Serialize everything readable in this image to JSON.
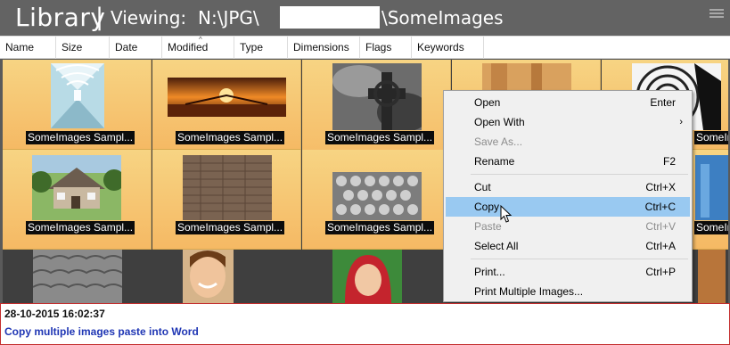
{
  "header": {
    "title": "Library",
    "separator": "|",
    "viewing_label": "Viewing:",
    "path_prefix": "N:\\JPG\\",
    "folder": "\\SomeImages"
  },
  "columns": [
    "Name",
    "Size",
    "Date",
    "Modified",
    "Type",
    "Dimensions",
    "Flags",
    "Keywords"
  ],
  "thumbnails": [
    {
      "caption": "SomeImages Sampl...",
      "icon": "corridor-photo",
      "selected": true
    },
    {
      "caption": "SomeImages Sampl...",
      "icon": "sunset-pier-photo",
      "selected": true
    },
    {
      "caption": "SomeImages Sampl...",
      "icon": "celtic-cross-photo",
      "selected": true
    },
    {
      "caption": "",
      "icon": "wood-texture-photo",
      "selected": true
    },
    {
      "caption": "SomeImages Sampl...",
      "icon": "spiral-staircase-photo",
      "selected": true
    },
    {
      "caption": "SomeImages Sampl...",
      "icon": "house-photo",
      "selected": true
    },
    {
      "caption": "SomeImages Sampl...",
      "icon": "brick-wall-photo",
      "selected": true
    },
    {
      "caption": "SomeImages Sampl...",
      "icon": "pattern-photo",
      "selected": true
    },
    {
      "caption": "",
      "icon": "blank",
      "selected": true
    },
    {
      "caption": "SomeImages Sampl...",
      "icon": "blue-building-photo",
      "selected": true
    },
    {
      "caption": "",
      "icon": "roof-tiles-photo",
      "selected": false
    },
    {
      "caption": "",
      "icon": "smiling-woman-photo",
      "selected": false
    },
    {
      "caption": "",
      "icon": "red-hood-photo",
      "selected": false
    },
    {
      "caption": "",
      "icon": "gray-photo",
      "selected": false
    },
    {
      "caption": "",
      "icon": "orange-photo",
      "selected": false
    }
  ],
  "context_menu": [
    {
      "label": "Open",
      "shortcut": "Enter",
      "disabled": false,
      "highlighted": false,
      "submenu": false
    },
    {
      "label": "Open With",
      "shortcut": "",
      "disabled": false,
      "highlighted": false,
      "submenu": true
    },
    {
      "label": "Save As...",
      "shortcut": "",
      "disabled": true,
      "highlighted": false,
      "submenu": false
    },
    {
      "label": "Rename",
      "shortcut": "F2",
      "disabled": false,
      "highlighted": false,
      "submenu": false
    },
    {
      "label": "Cut",
      "shortcut": "Ctrl+X",
      "disabled": false,
      "highlighted": false,
      "submenu": false
    },
    {
      "label": "Copy",
      "shortcut": "Ctrl+C",
      "disabled": false,
      "highlighted": true,
      "submenu": false
    },
    {
      "label": "Paste",
      "shortcut": "Ctrl+V",
      "disabled": true,
      "highlighted": false,
      "submenu": false
    },
    {
      "label": "Select All",
      "shortcut": "Ctrl+A",
      "disabled": false,
      "highlighted": false,
      "submenu": false
    },
    {
      "label": "Print...",
      "shortcut": "Ctrl+P",
      "disabled": false,
      "highlighted": false,
      "submenu": false
    },
    {
      "label": "Print Multiple Images...",
      "shortcut": "",
      "disabled": false,
      "highlighted": false,
      "submenu": false
    }
  ],
  "status": {
    "timestamp": "28-10-2015 16:02:37",
    "note": "Copy multiple images paste into Word"
  },
  "colors": {
    "header_bg": "#636363",
    "selection": "#f5c46f",
    "menu_highlight": "#99c9f1",
    "status_text": "#1f36b4",
    "status_border": "#c32d2d"
  }
}
